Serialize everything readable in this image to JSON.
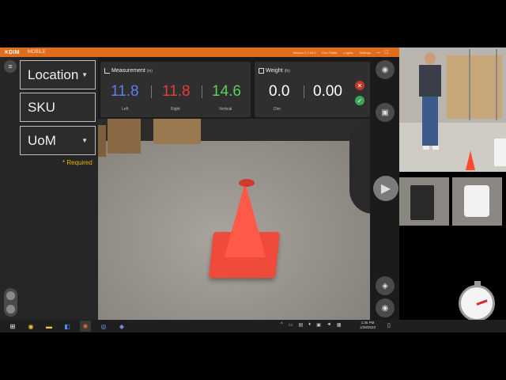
{
  "titlebar": {
    "logo_x": "✕",
    "logo_text": "DIM",
    "mode": "MOBILE",
    "version": "Version 2.7.16.0",
    "dev_fields": "Dev Fields",
    "logout": "Logout",
    "settings": "Settings",
    "accent_color": "#e06c1e"
  },
  "left": {
    "location_label": "Location",
    "sku_label": "SKU",
    "uom_label": "UoM",
    "required_text": "* Required"
  },
  "measurement": {
    "title": "Measurement",
    "unit": "(in)",
    "left_value": "11.8",
    "left_label": "Left",
    "right_value": "11.8",
    "right_label": "Right",
    "vertical_value": "14.6",
    "vertical_label": "Vertical",
    "colors": {
      "left": "#5b7ef0",
      "right": "#e83b3b",
      "vertical": "#5ad25a"
    }
  },
  "weight": {
    "title": "Weight",
    "unit": "(lb)",
    "dim_value": "0.0",
    "dim_label": "Dim",
    "weight_value": "0.00"
  },
  "taskbar": {
    "clock_time": "1:35 PM",
    "clock_date": "1/28/2023"
  },
  "icons": {
    "start": "windows-icon",
    "menu": "hamburger-icon",
    "play": "play-icon",
    "stopwatch": "stopwatch-icon",
    "layers": "layers-icon"
  }
}
